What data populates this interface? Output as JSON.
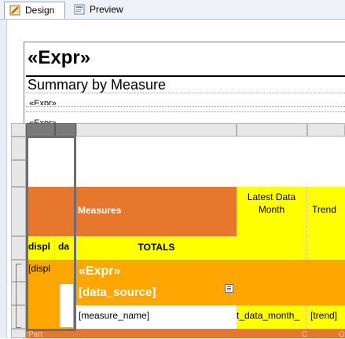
{
  "tabs": [
    {
      "label": "Design",
      "icon": "design-icon",
      "active": true
    },
    {
      "label": "Preview",
      "icon": "preview-icon",
      "active": false
    }
  ],
  "report": {
    "title_expr": "«Expr»",
    "subtitle": "Summary by Measure",
    "expr_line1": "«Expr»",
    "expr_line2": "«Expr»"
  },
  "table": {
    "header": {
      "measures": "Measures",
      "latest_data_month": "Latest Data Month",
      "trend": "Trend"
    },
    "totals_row": {
      "col1": "displ",
      "col2": "da",
      "totals": "TOTALS"
    },
    "group_row": {
      "col1": "[displ",
      "expr": "«Expr»"
    },
    "source_row": {
      "data_source": "[data_source]"
    },
    "detail_row": {
      "measure_name": "[measure_name]",
      "data_month": "t_data_month_",
      "trend": "[trend]"
    },
    "footer_row": {
      "part": "Part",
      "cur": "Cur",
      "g": "G"
    }
  },
  "colors": {
    "orange_dark": "#e8772e",
    "orange": "#ffa600",
    "yellow": "#ffff00"
  }
}
